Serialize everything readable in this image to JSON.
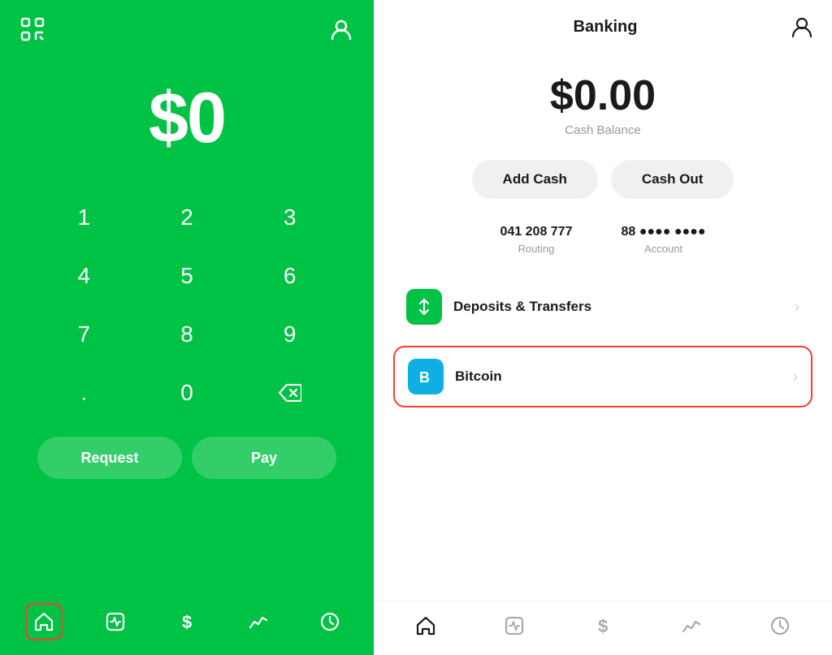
{
  "left": {
    "amount": "$0",
    "numpad": [
      "1",
      "2",
      "3",
      "4",
      "5",
      "6",
      "7",
      "8",
      "9",
      ".",
      "0",
      "⌫"
    ],
    "request_label": "Request",
    "pay_label": "Pay",
    "nav_items": [
      "home",
      "activity",
      "dollar",
      "graph",
      "clock"
    ]
  },
  "right": {
    "title": "Banking",
    "balance": "$0.00",
    "balance_label": "Cash Balance",
    "add_cash_label": "Add Cash",
    "cash_out_label": "Cash Out",
    "routing_number": "041 208 777",
    "routing_label": "Routing",
    "account_number": "88 ●●●● ●●●●",
    "account_label": "Account",
    "menu_items": [
      {
        "id": "deposits",
        "icon_type": "green",
        "icon": "transfers",
        "label": "Deposits & Transfers"
      },
      {
        "id": "bitcoin",
        "icon_type": "blue",
        "icon": "bitcoin",
        "label": "Bitcoin",
        "highlighted": true
      }
    ],
    "nav_items": [
      "home",
      "activity",
      "dollar",
      "graph",
      "clock"
    ]
  },
  "colors": {
    "green": "#00C244",
    "red": "#FF3B30",
    "blue": "#0EB0E4"
  }
}
